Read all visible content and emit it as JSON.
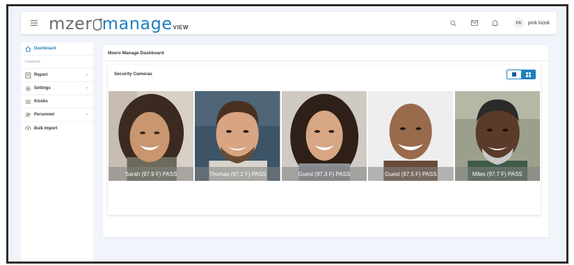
{
  "header": {
    "brand_part1": "mzer",
    "brand_part2": "manage",
    "brand_suffix": "VIEW",
    "user_initials": "PK",
    "user_name": "pmk kiosk",
    "icons": [
      "search-icon",
      "mail-icon",
      "bell-icon"
    ]
  },
  "sidebar": {
    "dashboard": "Dashboard",
    "section_label": "Features",
    "items": [
      {
        "label": "Report",
        "icon": "report-icon",
        "has_children": true
      },
      {
        "label": "Settings",
        "icon": "gear-icon",
        "has_children": true
      },
      {
        "label": "Kiosks",
        "icon": "list-icon",
        "has_children": false
      },
      {
        "label": "Personnel",
        "icon": "people-icon",
        "has_children": true
      },
      {
        "label": "Bulk Import",
        "icon": "cloud-upload-icon",
        "has_children": false
      }
    ]
  },
  "main": {
    "title": "Mzero Manage Dashboard",
    "cameras_title": "Security Cameras",
    "view_modes": [
      "single-view",
      "grid-view"
    ],
    "active_view": "grid-view",
    "cameras": [
      {
        "label": "Sarah (97.9 F)  PASS"
      },
      {
        "label": "Thomas (97.2 F)  PASS"
      },
      {
        "label": "Guest (97.3 F)  PASS"
      },
      {
        "label": "Guest (97.5 F)  PASS"
      },
      {
        "label": "Miles (97.7 F)  PASS"
      }
    ]
  },
  "colors": {
    "accent": "#1e7fc0",
    "background": "#f1f4fa",
    "label_overlay": "#8a8a8a"
  }
}
